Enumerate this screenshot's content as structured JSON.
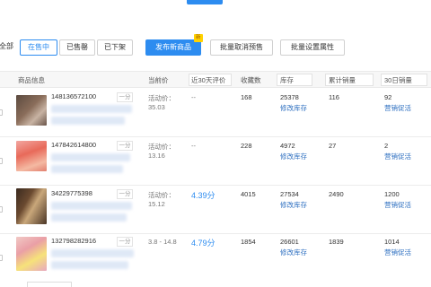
{
  "filters": {
    "all_label": "全部",
    "on_sale_label": "在售中",
    "sold_out_label": "已售罄",
    "off_shelf_label": "已下架"
  },
  "actions": {
    "publish_label": "发布新商品",
    "publish_badge": "新",
    "batch_cancel_presale_label": "批量取消预售",
    "batch_set_attrs_label": "批量设置属性"
  },
  "table": {
    "headers": {
      "product_info": "商品信息",
      "current_price": "当前价",
      "rating_30d": "近30天评价",
      "favorites": "收藏数",
      "stock": "库存",
      "total_sales": "累计销量",
      "sales_30d": "30日销量"
    },
    "rows": [
      {
        "product_id": "148136572100",
        "score_label": "一分",
        "price_label": "活动价：",
        "price": "35.03",
        "rating": "--",
        "favorites": "168",
        "stock": "25378",
        "stock_link": "修改库存",
        "total_sales": "116",
        "sales_30d": "92",
        "promo_link": "营销促活"
      },
      {
        "product_id": "147842614800",
        "score_label": "一分",
        "price_label": "活动价：",
        "price": "13.16",
        "rating": "--",
        "favorites": "228",
        "stock": "4972",
        "stock_link": "修改库存",
        "total_sales": "27",
        "sales_30d": "2",
        "promo_link": "营销促活"
      },
      {
        "product_id": "34229775398",
        "score_label": "一分",
        "price_label": "活动价：",
        "price": "15.12",
        "rating": "4.39分",
        "favorites": "4015",
        "stock": "27534",
        "stock_link": "修改库存",
        "total_sales": "2490",
        "sales_30d": "1200",
        "promo_link": "营销促活"
      },
      {
        "product_id": "132798282916",
        "score_label": "一分",
        "price_label": "",
        "price": "3.8 - 14.8",
        "rating": "4.79分",
        "favorites": "1854",
        "stock": "26601",
        "stock_link": "修改库存",
        "total_sales": "1839",
        "sales_30d": "1014",
        "promo_link": "营销促活"
      }
    ]
  },
  "colors": {
    "accent": "#2d8cf0",
    "link": "#2d6fc0",
    "badge": "#ffd200"
  }
}
